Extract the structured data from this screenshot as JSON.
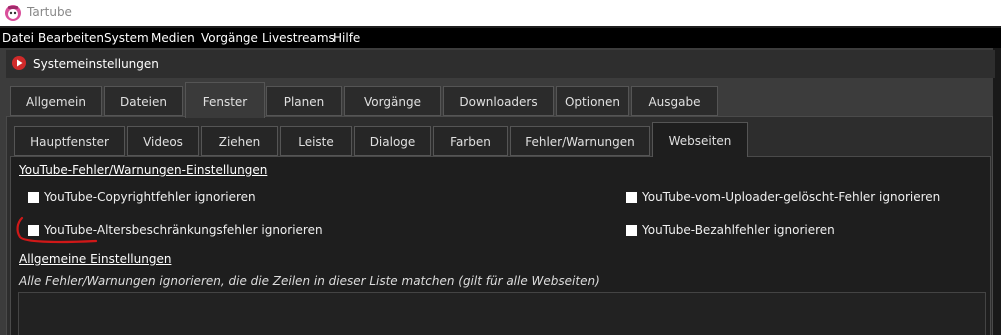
{
  "window": {
    "title": "Tartube"
  },
  "menubar": {
    "items": [
      "Datei",
      "Bearbeiten",
      "System",
      "Medien",
      "Vorgänge",
      "Livestreams",
      "Hilfe"
    ]
  },
  "dialog": {
    "title": "Systemeinstellungen"
  },
  "main_tabs": [
    "Allgemein",
    "Dateien",
    "Fenster",
    "Planen",
    "Vorgänge",
    "Downloaders",
    "Optionen",
    "Ausgabe"
  ],
  "main_tab_active": "Fenster",
  "sub_tabs": [
    "Hauptfenster",
    "Videos",
    "Ziehen",
    "Leiste",
    "Dialoge",
    "Farben",
    "Fehler/Warnungen",
    "Webseiten"
  ],
  "sub_tab_active": "Webseiten",
  "youtube_section": {
    "title": "YouTube-Fehler/Warnungen-Einstellungen",
    "checkboxes": [
      {
        "label": "YouTube-Copyrightfehler ignorieren",
        "checked": false
      },
      {
        "label": "YouTube-vom-Uploader-gelöscht-Fehler ignorieren",
        "checked": false
      },
      {
        "label": "YouTube-Altersbeschränkungsfehler ignorieren",
        "checked": false
      },
      {
        "label": "YouTube-Bezahlfehler ignorieren",
        "checked": false
      }
    ]
  },
  "general_section": {
    "title": "Allgemeine Einstellungen",
    "description": "Alle Fehler/Warnungen ignorieren, die die Zeilen in dieser Liste matchen (gilt für alle Webseiten)",
    "list_text": ""
  },
  "colors": {
    "annotation": "#d01818",
    "app_icon": "#d02a2a",
    "checkbox": "#ffffff"
  }
}
